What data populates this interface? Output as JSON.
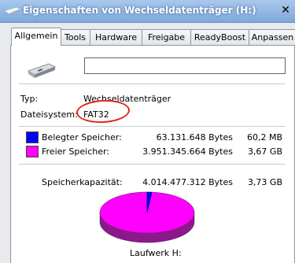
{
  "window": {
    "title": "Eigenschaften von Wechseldatenträger (H:)",
    "close_glyph": "✕"
  },
  "tabs": [
    {
      "label": "Allgemein",
      "active": true
    },
    {
      "label": "Tools",
      "active": false
    },
    {
      "label": "Hardware",
      "active": false
    },
    {
      "label": "Freigabe",
      "active": false
    },
    {
      "label": "ReadyBoost",
      "active": false
    },
    {
      "label": "Anpassen",
      "active": false
    }
  ],
  "general": {
    "name_value": "",
    "type_label": "Typ:",
    "type_value": "Wechseldatenträger",
    "fs_label": "Dateisystem:",
    "fs_value": "FAT32"
  },
  "usage": {
    "used_label": "Belegter Speicher:",
    "used_bytes": "63.131.648 Bytes",
    "used_size": "60,2 MB",
    "used_fraction": 0.0157,
    "free_label": "Freier Speicher:",
    "free_bytes": "3.951.345.664 Bytes",
    "free_size": "3,67 GB",
    "capacity_label": "Speicherkapazität:",
    "capacity_bytes": "4.014.477.312 Bytes",
    "capacity_size": "3,73 GB",
    "drive_label": "Laufwerk H:"
  },
  "colors": {
    "used": "#0000ff",
    "free": "#ff00ff",
    "annotation": "#e3261c"
  },
  "icons": {
    "title": "removable-drive-icon",
    "drive": "removable-drive-icon"
  }
}
